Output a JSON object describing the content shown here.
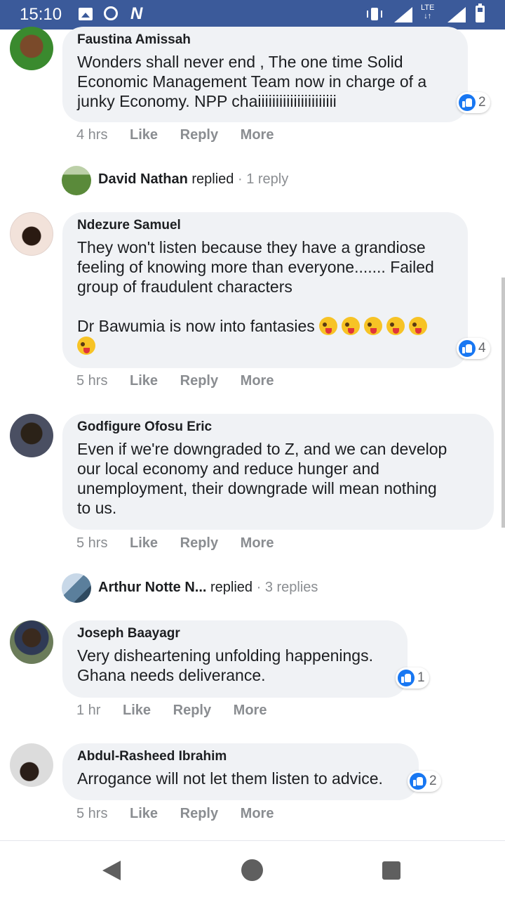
{
  "status_bar": {
    "time": "15:10",
    "network_label": "LTE",
    "icons": [
      "image-icon",
      "whatsapp-icon",
      "n-icon",
      "vibrate-icon",
      "signal-icon",
      "signal-icon",
      "battery-icon"
    ]
  },
  "comments": [
    {
      "author": "Faustina Amissah",
      "text": "Wonders shall never end , The one time Solid\nEconomic Management Team now in charge of a\njunky Economy. NPP chaiiiiiiiiiiiiiiiiiiiiii",
      "reactions": "2",
      "time": "4 hrs",
      "avatar_color": "#3a8a2e"
    },
    {
      "author": "Ndezure Samuel",
      "text_lines": "They won't listen because they have a grandiose\nfeeling of knowing more than everyone....... Failed\ngroup of fraudulent characters\n\nDr Bawumia is now into fantasies",
      "emojis": 6,
      "reactions": "4",
      "time": "5 hrs",
      "avatar_color": "#e8cfc4"
    },
    {
      "author": "Godfigure Ofosu Eric",
      "text": "Even if we're downgraded to Z, and we can develop\nour local economy and reduce hunger and\nunemployment, their downgrade will mean nothing\nto us.",
      "time": "5 hrs",
      "avatar_color": "#4a4f62"
    },
    {
      "author": "Joseph Baayagr",
      "text": "Very disheartening unfolding happenings.\nGhana needs deliverance.",
      "reactions": "1",
      "time": "1 hr",
      "avatar_color": "#6b7c5a"
    },
    {
      "author": "Abdul-Rasheed Ibrahim",
      "text": "Arrogance will not let them listen to advice.",
      "reactions": "2",
      "time": "5 hrs",
      "avatar_color": "#c9c9c9"
    }
  ],
  "replies": [
    {
      "name": "David Nathan",
      "verb": "replied",
      "count": "1 reply",
      "avatar_color": "#5a8a3a"
    },
    {
      "name": "Arthur Notte N...",
      "verb": "replied",
      "count": "3 replies",
      "avatar_color": "#5b7f9c"
    }
  ],
  "actions": {
    "like": "Like",
    "reply": "Reply",
    "more": "More"
  },
  "separator": " · "
}
